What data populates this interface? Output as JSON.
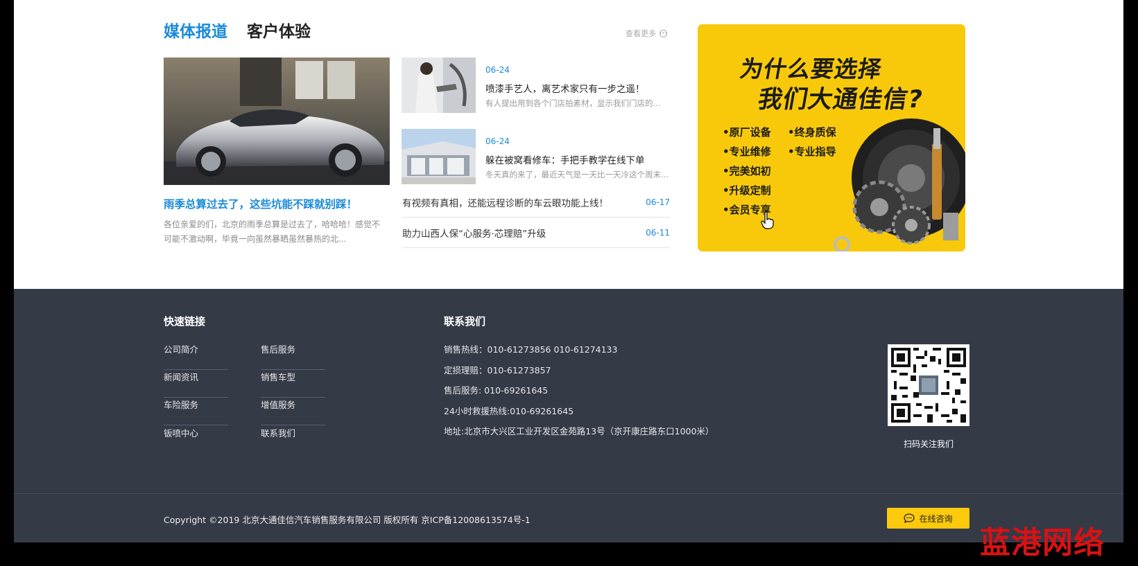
{
  "news": {
    "tabs": [
      {
        "label": "媒体报道"
      },
      {
        "label": "客户体验"
      }
    ],
    "more_label": "查看更多",
    "featured": {
      "title": "雨季总算过去了，这些坑能不踩就别踩！",
      "description": "各位亲爱的们，北京的雨季总算是过去了，哈哈哈！感觉不可能不激动啊，毕竟一向虽然暴晒虽然暴热的北..."
    },
    "items": [
      {
        "date": "06-24",
        "title": "喷漆手艺人，离艺术家只有一步之遥！",
        "description": "有人提出用到各个门店拍素材，显示我们门店的..."
      },
      {
        "date": "06-24",
        "title": "躲在被窝看修车：手把手教学在线下单",
        "description": "冬天真的来了，最近天气是一天比一天冷这个周末..."
      }
    ],
    "list": [
      {
        "title": "有视频有真相，还能远程诊断的车云眼功能上线！",
        "date": "06-17"
      },
      {
        "title": "助力山西人保“心服务·芯理赔”升级",
        "date": "06-11"
      }
    ]
  },
  "banner": {
    "line1": "为什么要选择",
    "line2": "我们大通佳信?",
    "features": [
      "•原厂设备",
      "•终身质保",
      "•专业维修",
      "•专业指导",
      "•完美如初",
      "•升级定制",
      "•会员专享"
    ]
  },
  "footer": {
    "quick_links_heading": "快速链接",
    "quick_links": [
      "公司简介",
      "售后服务",
      "新闻资讯",
      "销售车型",
      "车险服务",
      "增值服务",
      "钣喷中心",
      "联系我们"
    ],
    "contact_heading": "联系我们",
    "contacts": [
      "销售热线：010-61273856  010-61274133",
      "定损理赔：010-61273857",
      "售后服务: 010-69261645",
      "24小时救援热线:010-69261645",
      "地址:北京市大兴区工业开发区金苑路13号（京开康庄路东口1000米）"
    ],
    "qr_caption": "扫码关注我们",
    "copyright": "Copyright ©2019 北京大通佳信汽车销售服务有限公司 版权所有 京ICP备12008613574号-1",
    "consult_label": "在线咨询"
  },
  "watermark": "蓝港网络",
  "colors": {
    "accent": "#1a8ad9",
    "footer_bg": "#353a47",
    "banner_yellow": "#f8c90a",
    "watermark_red": "#d81215"
  }
}
